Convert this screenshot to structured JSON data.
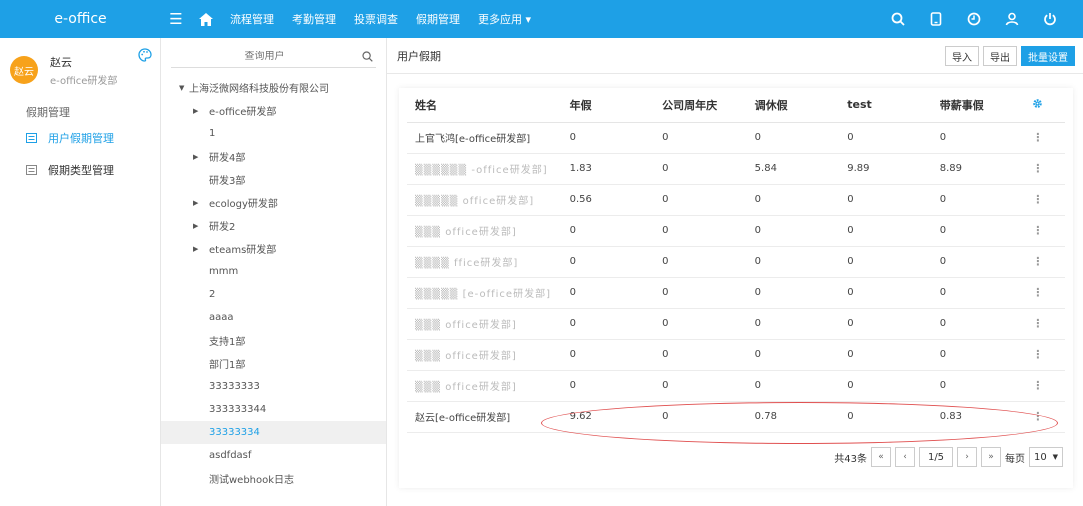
{
  "app": {
    "brand": "e-office"
  },
  "topnav": {
    "items": [
      "流程管理",
      "考勤管理",
      "投票调查",
      "假期管理"
    ],
    "more": "更多应用 ▾"
  },
  "user": {
    "name": "赵云",
    "dept": "e-office研发部",
    "avatar_text": "赵云"
  },
  "sidebar": {
    "group": "假期管理",
    "items": [
      {
        "label": "用户假期管理",
        "active": true
      },
      {
        "label": "假期类型管理",
        "active": false
      }
    ]
  },
  "tree": {
    "search_placeholder": "查询用户",
    "root": "上海泛微网络科技股份有限公司",
    "nodes": [
      {
        "label": "e-office研发部",
        "expandable": true
      },
      {
        "label": "1",
        "expandable": false
      },
      {
        "label": "研发4部",
        "expandable": true
      },
      {
        "label": "研发3部",
        "expandable": false
      },
      {
        "label": "ecology研发部",
        "expandable": true
      },
      {
        "label": "研发2",
        "expandable": true
      },
      {
        "label": "eteams研发部",
        "expandable": true
      },
      {
        "label": "mmm",
        "expandable": false
      },
      {
        "label": "2",
        "expandable": false
      },
      {
        "label": "aaaa",
        "expandable": false
      },
      {
        "label": "支持1部",
        "expandable": false
      },
      {
        "label": "部门1部",
        "expandable": false
      },
      {
        "label": "33333333",
        "expandable": false
      },
      {
        "label": "333333344",
        "expandable": false
      },
      {
        "label": "33333334",
        "expandable": false,
        "selected": true
      },
      {
        "label": "asdfdasf",
        "expandable": false
      },
      {
        "label": "测试webhook日志",
        "expandable": false
      }
    ]
  },
  "content": {
    "title": "用户假期",
    "buttons": {
      "import": "导入",
      "export": "导出",
      "batch": "批量设置"
    },
    "table": {
      "headers": [
        "姓名",
        "年假",
        "公司周年庆",
        "调休假",
        "test",
        "带薪事假"
      ],
      "rows": [
        [
          "上官飞鸿[e-office研发部]",
          "0",
          "0",
          "0",
          "0",
          "0"
        ],
        [
          "▒▒▒▒▒▒ -office研发部]",
          "1.83",
          "0",
          "5.84",
          "9.89",
          "8.89"
        ],
        [
          "▒▒▒▒▒ office研发部]",
          "0.56",
          "0",
          "0",
          "0",
          "0"
        ],
        [
          "▒▒▒ office研发部]",
          "0",
          "0",
          "0",
          "0",
          "0"
        ],
        [
          "▒▒▒▒ ffice研发部]",
          "0",
          "0",
          "0",
          "0",
          "0"
        ],
        [
          "▒▒▒▒▒ [e-office研发部]",
          "0",
          "0",
          "0",
          "0",
          "0"
        ],
        [
          "▒▒▒ office研发部]",
          "0",
          "0",
          "0",
          "0",
          "0"
        ],
        [
          "▒▒▒ office研发部]",
          "0",
          "0",
          "0",
          "0",
          "0"
        ],
        [
          "▒▒▒ office研发部]",
          "0",
          "0",
          "0",
          "0",
          "0"
        ],
        [
          "赵云[e-office研发部]",
          "9.62",
          "0",
          "0.78",
          "0",
          "0.83"
        ]
      ]
    },
    "pager": {
      "total": "共43条",
      "first": "«",
      "prev": "‹",
      "page": "1/5",
      "next": "›",
      "last": "»",
      "per_page_label": "每页",
      "per_page": "10"
    }
  },
  "colors": {
    "primary": "#1ea0e6",
    "avatar": "#f7a21b",
    "highlight": "#e05050"
  }
}
